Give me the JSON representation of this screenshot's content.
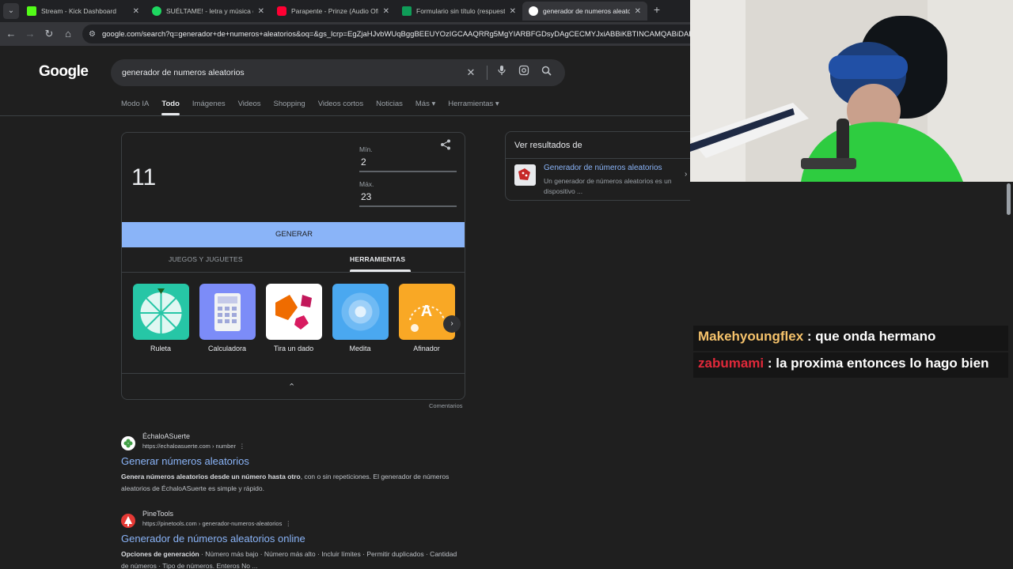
{
  "browser": {
    "tabs": [
      {
        "label": "Stream - Kick Dashboard",
        "color": "#53fc18",
        "active": false
      },
      {
        "label": "SUÉLTAME! - letra y música de",
        "color": "#1ed760",
        "active": false
      },
      {
        "label": "Parapente - Prinze (Audio Ofici",
        "color": "#ff0033",
        "active": false
      },
      {
        "label": "Formulario sin título (respuesta",
        "color": "#0f9d58",
        "active": false
      },
      {
        "label": "generador de numeros aleator",
        "color": "#ffffff",
        "active": true
      }
    ],
    "new_tab": "+",
    "url": "google.com/search?q=generador+de+numeros+aleatorios&oq=&gs_lcrp=EgZjaHJvbWUqBggBEEUYOzIGCAAQRRg5MgYIARBFGDsyDAgCECMYJxiABBiKBTINCAMQABiDARixAxiABD"
  },
  "google": {
    "logo": "Google",
    "query": "generador de numeros aleatorios",
    "nav_tabs": [
      "Modo IA",
      "Todo",
      "Imágenes",
      "Videos",
      "Shopping",
      "Videos cortos",
      "Noticias",
      "Más ▾",
      "Herramientas ▾"
    ],
    "active_tab": "Todo"
  },
  "widget": {
    "result": "11",
    "min_label": "Mín.",
    "min_value": "2",
    "max_label": "Máx.",
    "max_value": "23",
    "generate_label": "GENERAR",
    "subtab_games": "JUEGOS Y JUGUETES",
    "subtab_tools": "HERRAMIENTAS",
    "tools": [
      {
        "name": "Ruleta",
        "color": "#26c6a6"
      },
      {
        "name": "Calculadora",
        "color": "#7c8cf8"
      },
      {
        "name": "Tira un dado",
        "color": "#ffffff"
      },
      {
        "name": "Medita",
        "color": "#4aa8f0"
      },
      {
        "name": "Afinador",
        "color": "#f9a825"
      }
    ],
    "tuner_letter": "A",
    "comentarios": "Comentarios"
  },
  "results": [
    {
      "site": "ÉchaloASuerte",
      "url": "https://echaloasuerte.com › number",
      "title": "Generar números aleatorios",
      "snippet_bold": "Genera números aleatorios desde un número hasta otro",
      "snippet_rest": ", con o sin repeticiones. El generador de números aleatorios de ÉchaloASuerte es simple y rápido."
    },
    {
      "site": "PineTools",
      "url": "https://pinetools.com › generador-numeros-aleatorios",
      "title": "Generador de números aleatorios online",
      "snippet_bold": "Opciones de generación",
      "snippet_rest": " · Número más bajo · Número más alto · Incluir límites · Permitir duplicados · Cantidad de números · Tipo de números. Enteros No ..."
    }
  ],
  "side_panel": {
    "heading": "Ver resultados de",
    "title": "Generador de números aleatorios",
    "description": "Un generador de números aleatorios es un dispositivo ..."
  },
  "chat": [
    {
      "user": "Makehyoungflex",
      "user_color": "#f5c26b",
      "message": " : que onda hermano"
    },
    {
      "user": "zabumami",
      "user_color": "#e0293a",
      "message": " : la proxima entonces lo hago bien"
    }
  ]
}
